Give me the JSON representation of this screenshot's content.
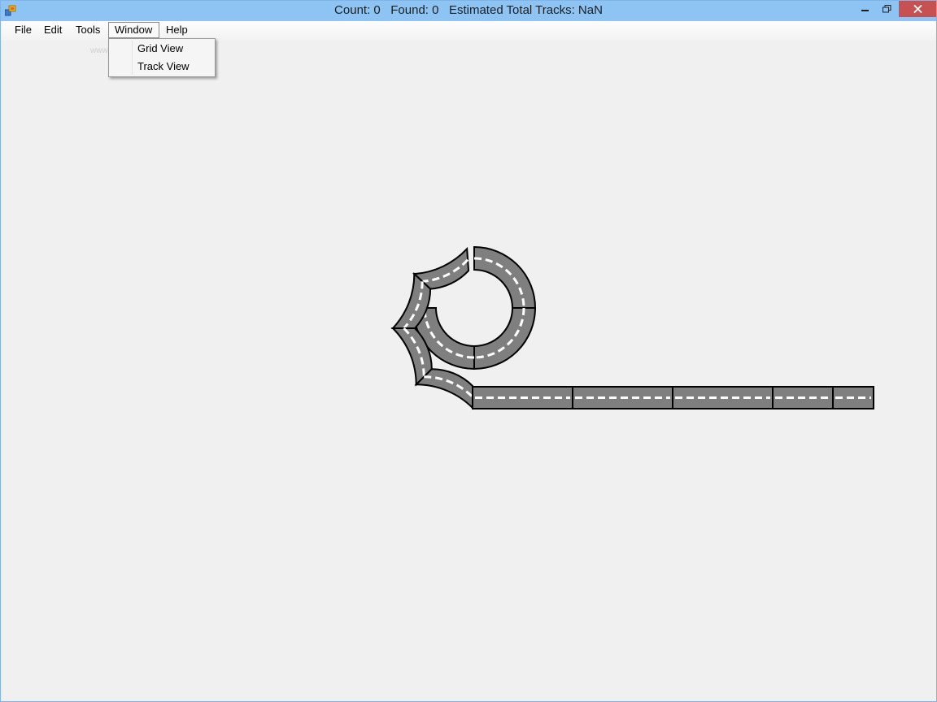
{
  "titlebar": {
    "title": "Count: 0   Found: 0   Estimated Total Tracks: NaN"
  },
  "menubar": {
    "items": [
      {
        "label": "File"
      },
      {
        "label": "Edit"
      },
      {
        "label": "Tools"
      },
      {
        "label": "Window"
      },
      {
        "label": "Help"
      }
    ]
  },
  "window_menu": {
    "items": [
      {
        "label": "Grid View"
      },
      {
        "label": "Track View"
      }
    ]
  },
  "watermark": "www.softpedia.com",
  "track": {
    "colors": {
      "asphalt": "#7f7f7f",
      "edge": "#000000",
      "stripe": "#ffffff"
    }
  }
}
